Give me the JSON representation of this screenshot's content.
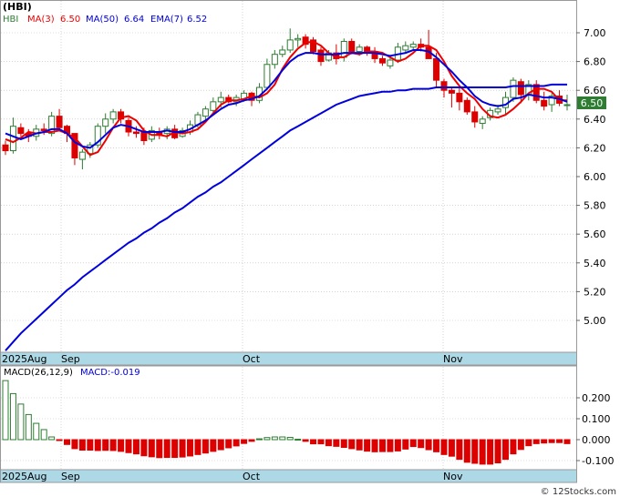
{
  "title": "(HBI)",
  "copyright": "© 12Stocks.com",
  "price_panel": {
    "legend": {
      "ticker": "HBI",
      "ma3_label": "MA(3)",
      "ma3_value": "6.50",
      "ma50_label": "MA(50)",
      "ma50_value": "6.64",
      "ema7_label": "EMA(7)",
      "ema7_value": "6.52"
    },
    "last_price_label": "6.50",
    "y_ticks": [
      "7.00",
      "6.80",
      "6.60",
      "6.40",
      "6.20",
      "6.00",
      "5.80",
      "5.60",
      "5.40",
      "5.20",
      "5.00"
    ],
    "x_labels": [
      "2025Aug",
      "Sep",
      "Oct",
      "Nov"
    ]
  },
  "macd_panel": {
    "legend": {
      "label": "MACD(26,12,9)",
      "value_label": "MACD:-0.019"
    },
    "y_ticks": [
      "0.200",
      "0.100",
      "0.000",
      "-0.100"
    ],
    "x_labels": [
      "2025Aug",
      "Sep",
      "Oct",
      "Nov"
    ]
  },
  "colors": {
    "up_candle": "#2e7d32",
    "down_candle": "#dd0000",
    "ma_blue": "#0000dd",
    "ema_red": "#ee0000",
    "axis_band": "#add8e6",
    "grid": "#bbbbbb",
    "macd_pos": "#2e7d32",
    "macd_neg": "#dd0000"
  },
  "chart_data": [
    {
      "type": "candlestick",
      "title": "(HBI)",
      "x_labels": [
        "2025Aug",
        "Sep",
        "Oct",
        "Nov"
      ],
      "ylim": [
        4.8,
        7.1
      ],
      "y_scale": "linear",
      "grid": true,
      "candles": [
        [
          6.22,
          6.25,
          6.15,
          6.18
        ],
        [
          6.18,
          6.41,
          6.16,
          6.35
        ],
        [
          6.34,
          6.37,
          6.28,
          6.3
        ],
        [
          6.3,
          6.33,
          6.24,
          6.28
        ],
        [
          6.28,
          6.36,
          6.25,
          6.33
        ],
        [
          6.33,
          6.37,
          6.29,
          6.32
        ],
        [
          6.3,
          6.45,
          6.28,
          6.42
        ],
        [
          6.42,
          6.47,
          6.32,
          6.34
        ],
        [
          6.35,
          6.36,
          6.24,
          6.3
        ],
        [
          6.3,
          6.3,
          6.08,
          6.13
        ],
        [
          6.12,
          6.19,
          6.05,
          6.17
        ],
        [
          6.16,
          6.24,
          6.13,
          6.22
        ],
        [
          6.22,
          6.37,
          6.2,
          6.35
        ],
        [
          6.35,
          6.44,
          6.3,
          6.4
        ],
        [
          6.4,
          6.47,
          6.37,
          6.45
        ],
        [
          6.45,
          6.47,
          6.37,
          6.4
        ],
        [
          6.39,
          6.41,
          6.28,
          6.31
        ],
        [
          6.31,
          6.35,
          6.27,
          6.3
        ],
        [
          6.31,
          6.34,
          6.22,
          6.25
        ],
        [
          6.26,
          6.35,
          6.24,
          6.32
        ],
        [
          6.31,
          6.34,
          6.26,
          6.29
        ],
        [
          6.3,
          6.35,
          6.26,
          6.33
        ],
        [
          6.33,
          6.36,
          6.26,
          6.27
        ],
        [
          6.28,
          6.34,
          6.27,
          6.32
        ],
        [
          6.31,
          6.39,
          6.29,
          6.36
        ],
        [
          6.36,
          6.45,
          6.34,
          6.43
        ],
        [
          6.42,
          6.49,
          6.38,
          6.47
        ],
        [
          6.46,
          6.55,
          6.43,
          6.52
        ],
        [
          6.52,
          6.59,
          6.48,
          6.55
        ],
        [
          6.55,
          6.57,
          6.51,
          6.52
        ],
        [
          6.52,
          6.57,
          6.49,
          6.55
        ],
        [
          6.54,
          6.6,
          6.52,
          6.58
        ],
        [
          6.58,
          6.59,
          6.49,
          6.53
        ],
        [
          6.53,
          6.65,
          6.51,
          6.62
        ],
        [
          6.62,
          6.82,
          6.6,
          6.78
        ],
        [
          6.78,
          6.88,
          6.75,
          6.85
        ],
        [
          6.85,
          6.91,
          6.83,
          6.88
        ],
        [
          6.88,
          7.03,
          6.86,
          6.95
        ],
        [
          6.95,
          6.99,
          6.9,
          6.96
        ],
        [
          6.97,
          6.99,
          6.89,
          6.92
        ],
        [
          6.95,
          6.97,
          6.85,
          6.87
        ],
        [
          6.88,
          6.9,
          6.77,
          6.8
        ],
        [
          6.81,
          6.88,
          6.8,
          6.86
        ],
        [
          6.86,
          6.92,
          6.78,
          6.82
        ],
        [
          6.83,
          6.96,
          6.8,
          6.94
        ],
        [
          6.94,
          6.96,
          6.85,
          6.87
        ],
        [
          6.87,
          6.92,
          6.84,
          6.9
        ],
        [
          6.9,
          6.91,
          6.84,
          6.86
        ],
        [
          6.87,
          6.9,
          6.79,
          6.82
        ],
        [
          6.82,
          6.84,
          6.77,
          6.79
        ],
        [
          6.77,
          6.83,
          6.75,
          6.81
        ],
        [
          6.81,
          6.93,
          6.79,
          6.9
        ],
        [
          6.88,
          6.94,
          6.86,
          6.91
        ],
        [
          6.9,
          6.94,
          6.88,
          6.92
        ],
        [
          6.92,
          6.96,
          6.87,
          6.9
        ],
        [
          6.9,
          7.02,
          6.85,
          6.82
        ],
        [
          6.82,
          6.86,
          6.62,
          6.67
        ],
        [
          6.66,
          6.68,
          6.55,
          6.6
        ],
        [
          6.6,
          6.62,
          6.48,
          6.58
        ],
        [
          6.58,
          6.62,
          6.46,
          6.52
        ],
        [
          6.53,
          6.55,
          6.43,
          6.45
        ],
        [
          6.45,
          6.49,
          6.34,
          6.38
        ],
        [
          6.37,
          6.42,
          6.33,
          6.4
        ],
        [
          6.41,
          6.48,
          6.39,
          6.46
        ],
        [
          6.45,
          6.5,
          6.43,
          6.47
        ],
        [
          6.48,
          6.59,
          6.43,
          6.55
        ],
        [
          6.55,
          6.69,
          6.52,
          6.67
        ],
        [
          6.66,
          6.68,
          6.51,
          6.57
        ],
        [
          6.57,
          6.67,
          6.53,
          6.64
        ],
        [
          6.64,
          6.67,
          6.51,
          6.53
        ],
        [
          6.53,
          6.59,
          6.46,
          6.49
        ],
        [
          6.5,
          6.58,
          6.45,
          6.56
        ],
        [
          6.56,
          6.6,
          6.49,
          6.51
        ],
        [
          6.5,
          6.57,
          6.46,
          6.5
        ]
      ],
      "series": [
        {
          "name": "MA(3)",
          "values": [
            6.26,
            6.24,
            6.27,
            6.31,
            6.3,
            6.31,
            6.31,
            6.32,
            6.3,
            6.27,
            6.21,
            6.15,
            6.17,
            6.25,
            6.34,
            6.41,
            6.42,
            6.39,
            6.32,
            6.29,
            6.29,
            6.28,
            6.31,
            6.3,
            6.31,
            6.33,
            6.38,
            6.44,
            6.5,
            6.53,
            6.53,
            6.54,
            6.56,
            6.55,
            6.58,
            6.64,
            6.75,
            6.83,
            6.89,
            6.93,
            6.94,
            6.91,
            6.86,
            6.83,
            6.83,
            6.86,
            6.85,
            6.87,
            6.87,
            6.86,
            6.83,
            6.8,
            6.82,
            6.86,
            6.91,
            6.91,
            6.88,
            6.8,
            6.7,
            6.63,
            6.58,
            6.54,
            6.47,
            6.42,
            6.41,
            6.43,
            6.47,
            6.52,
            6.58,
            6.61,
            6.61,
            6.59,
            6.53,
            6.53
          ]
        },
        {
          "name": "MA(50)",
          "values": [
            4.79,
            4.85,
            4.91,
            4.96,
            5.01,
            5.06,
            5.11,
            5.16,
            5.21,
            5.25,
            5.3,
            5.34,
            5.38,
            5.42,
            5.46,
            5.5,
            5.54,
            5.57,
            5.61,
            5.64,
            5.68,
            5.71,
            5.75,
            5.78,
            5.82,
            5.86,
            5.89,
            5.93,
            5.96,
            6.0,
            6.04,
            6.08,
            6.12,
            6.16,
            6.2,
            6.24,
            6.28,
            6.32,
            6.35,
            6.38,
            6.41,
            6.44,
            6.47,
            6.5,
            6.52,
            6.54,
            6.56,
            6.57,
            6.58,
            6.59,
            6.59,
            6.6,
            6.6,
            6.61,
            6.61,
            6.61,
            6.62,
            6.62,
            6.62,
            6.62,
            6.62,
            6.62,
            6.62,
            6.62,
            6.62,
            6.62,
            6.63,
            6.63,
            6.63,
            6.63,
            6.63,
            6.64,
            6.64,
            6.64
          ]
        },
        {
          "name": "EMA(7)",
          "values": [
            6.3,
            6.28,
            6.26,
            6.28,
            6.3,
            6.31,
            6.33,
            6.33,
            6.3,
            6.24,
            6.21,
            6.2,
            6.24,
            6.29,
            6.34,
            6.36,
            6.35,
            6.33,
            6.31,
            6.31,
            6.31,
            6.32,
            6.31,
            6.31,
            6.33,
            6.36,
            6.39,
            6.43,
            6.47,
            6.5,
            6.51,
            6.53,
            6.54,
            6.56,
            6.61,
            6.67,
            6.74,
            6.8,
            6.84,
            6.86,
            6.86,
            6.85,
            6.85,
            6.85,
            6.86,
            6.86,
            6.86,
            6.86,
            6.86,
            6.85,
            6.84,
            6.85,
            6.86,
            6.88,
            6.88,
            6.87,
            6.83,
            6.78,
            6.73,
            6.67,
            6.62,
            6.56,
            6.52,
            6.5,
            6.49,
            6.5,
            6.54,
            6.55,
            6.57,
            6.56,
            6.55,
            6.55,
            6.54,
            6.52
          ]
        }
      ]
    },
    {
      "type": "bar",
      "title": "MACD(26,12,9)",
      "x_labels": [
        "2025Aug",
        "Sep",
        "Oct",
        "Nov"
      ],
      "ylim": [
        -0.15,
        0.3
      ],
      "grid": true,
      "values": [
        0.282,
        0.22,
        0.17,
        0.12,
        0.078,
        0.048,
        0.013,
        -0.003,
        -0.023,
        -0.043,
        -0.05,
        -0.05,
        -0.052,
        -0.051,
        -0.052,
        -0.056,
        -0.062,
        -0.068,
        -0.077,
        -0.082,
        -0.086,
        -0.085,
        -0.085,
        -0.083,
        -0.078,
        -0.071,
        -0.064,
        -0.056,
        -0.048,
        -0.039,
        -0.03,
        -0.018,
        -0.008,
        0.004,
        0.01,
        0.013,
        0.013,
        0.011,
        0.002,
        -0.008,
        -0.02,
        -0.02,
        -0.029,
        -0.032,
        -0.037,
        -0.043,
        -0.049,
        -0.055,
        -0.058,
        -0.057,
        -0.057,
        -0.054,
        -0.045,
        -0.033,
        -0.038,
        -0.048,
        -0.058,
        -0.071,
        -0.079,
        -0.094,
        -0.108,
        -0.113,
        -0.117,
        -0.117,
        -0.111,
        -0.094,
        -0.068,
        -0.047,
        -0.029,
        -0.019,
        -0.016,
        -0.014,
        -0.014,
        -0.019
      ]
    }
  ]
}
